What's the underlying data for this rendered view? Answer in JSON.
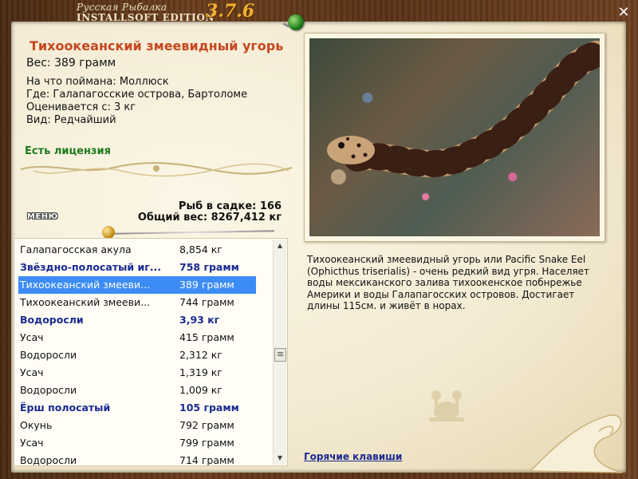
{
  "app": {
    "title_line1": "Русская Рыбалка",
    "title_line2": "INSTALLSOFT EDITION",
    "version": "3.7.6",
    "close_glyph": "✕"
  },
  "fish": {
    "name": "Тихоокеанский змеевидный угорь",
    "weight": "Вес: 389 грамм",
    "info": [
      "На что поймана: Моллюск",
      "Где: Галапагосские острова, Бартоломе",
      "Оценивается с: 3 кг",
      "Вид: Редчайший"
    ],
    "license": "Есть лицензия"
  },
  "stats": {
    "in_cage": "Рыб в садке: 166",
    "total_weight": "Общий вес: 8267,412 кг"
  },
  "menu_label": "МЕНЮ",
  "catch_list": [
    {
      "name": "Галапагосская акула",
      "weight": "8,854 кг",
      "bold": false,
      "selected": false
    },
    {
      "name": "Звёздно-полосатый иг...",
      "weight": "758 грамм",
      "bold": true,
      "selected": false
    },
    {
      "name": "Тихоокеанский змееви...",
      "weight": "389 грамм",
      "bold": false,
      "selected": true
    },
    {
      "name": "Тихоокеанский змееви...",
      "weight": "744 грамм",
      "bold": false,
      "selected": false
    },
    {
      "name": "Водоросли",
      "weight": "3,93 кг",
      "bold": true,
      "selected": false
    },
    {
      "name": "Усач",
      "weight": "415 грамм",
      "bold": false,
      "selected": false
    },
    {
      "name": "Водоросли",
      "weight": "2,312 кг",
      "bold": false,
      "selected": false
    },
    {
      "name": "Усач",
      "weight": "1,319 кг",
      "bold": false,
      "selected": false
    },
    {
      "name": "Водоросли",
      "weight": "1,009 кг",
      "bold": false,
      "selected": false
    },
    {
      "name": "Ёрш полосатый",
      "weight": "105 грамм",
      "bold": true,
      "selected": false
    },
    {
      "name": "Окунь",
      "weight": "792 грамм",
      "bold": false,
      "selected": false
    },
    {
      "name": "Усач",
      "weight": "799 грамм",
      "bold": false,
      "selected": false
    },
    {
      "name": "Водоросли",
      "weight": "714 грамм",
      "bold": false,
      "selected": false
    }
  ],
  "scrollbar": {
    "up_glyph": "▲",
    "down_glyph": "▼"
  },
  "description": "Тихоокеанский змеевидный угорь или Pacific Snake Eel (Ophicthus triserialis) - очень редкий вид угря. Населяет воды мексиканского залива тихоокенское побнрежье Америки и воды Галапагосских островов. Достигает длины 115см. и живёт в норах.",
  "hotkeys_label": "Горячие клавиши",
  "colors": {
    "title_red": "#c5481f",
    "license_green": "#1d7a1d",
    "bold_blue": "#1a2a8f",
    "selection_blue": "#3d8cf5",
    "version_gold": "#f0b030"
  },
  "icons": [
    "close-icon",
    "green-pin-icon",
    "gold-pin-icon",
    "crab-icon",
    "scroll-up-icon",
    "scroll-down-icon"
  ]
}
